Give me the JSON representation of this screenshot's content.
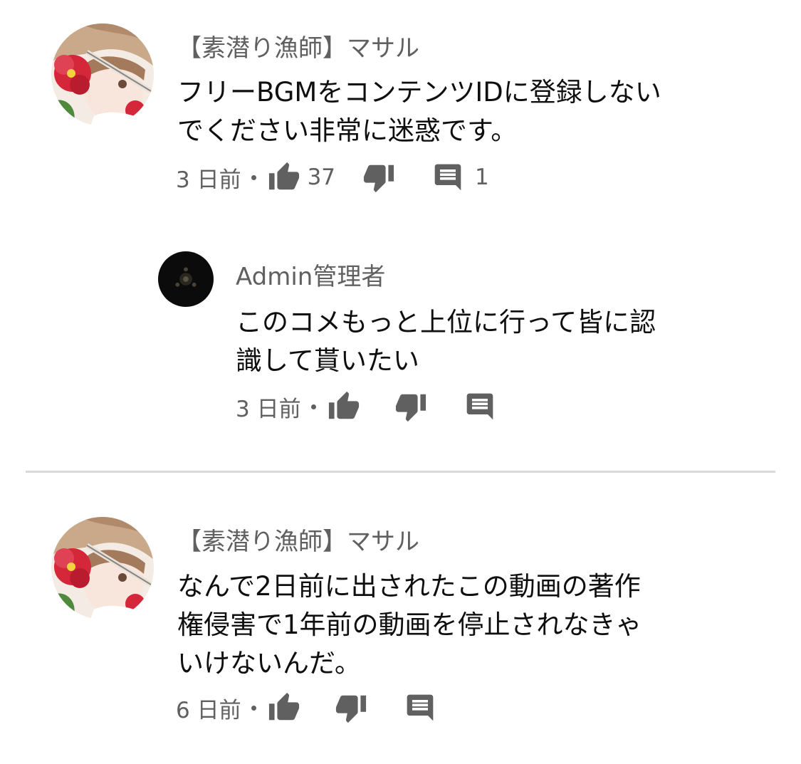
{
  "comments": [
    {
      "author": "【素潜り漁師】マサル",
      "text_lines": [
        "フリーBGMをコンテンツIDに登録しない",
        "でください非常に迷惑です。"
      ],
      "time": "3 日前",
      "likes": "37",
      "replies": "1",
      "avatar_icon": "anime-girl-red-flower-avatar"
    },
    {
      "author": "Admin管理者",
      "text_lines": [
        "このコメもっと上位に行って皆に認",
        "識して貰いたい"
      ],
      "time": "3 日前",
      "likes": "",
      "replies": "",
      "avatar_icon": "dark-emblem-avatar"
    },
    {
      "author": "【素潜り漁師】マサル",
      "text_lines": [
        "なんで2日前に出されたこの動画の著作",
        "権侵害で1年前の動画を停止されなきゃ",
        "いけないんだ。"
      ],
      "time": "6 日前",
      "likes": "",
      "replies": "",
      "avatar_icon": "anime-girl-red-flower-avatar"
    }
  ],
  "icons": {
    "like": "thumb-up-icon",
    "dislike": "thumb-down-icon",
    "reply": "comment-icon"
  },
  "colors": {
    "text_primary": "#0f0f0f",
    "text_secondary": "#606060",
    "divider": "#d9d9d9"
  }
}
